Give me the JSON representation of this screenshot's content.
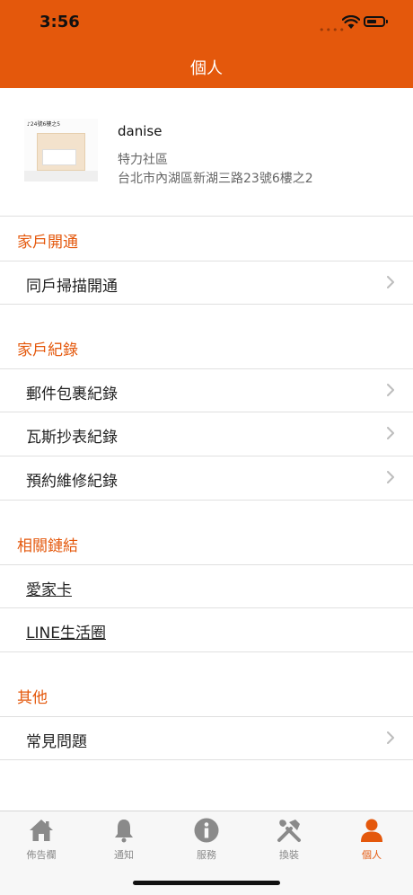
{
  "status": {
    "time": "3:56"
  },
  "header": {
    "title": "個人"
  },
  "profile": {
    "image_caption": "♪24號6樓之5",
    "username": "danise",
    "community": "特力社區",
    "address": "台北市內湖區新湖三路23號6樓之2"
  },
  "sections": {
    "activation": {
      "title": "家戶開通",
      "items": [
        {
          "label": "同戶掃描開通"
        }
      ]
    },
    "records": {
      "title": "家戶紀錄",
      "items": [
        {
          "label": "郵件包裹紀錄"
        },
        {
          "label": "瓦斯抄表紀錄"
        },
        {
          "label": "預約維修紀錄"
        }
      ]
    },
    "links": {
      "title": "相關鏈結",
      "items": [
        {
          "label": "愛家卡"
        },
        {
          "label": "LINE生活圈"
        }
      ]
    },
    "other": {
      "title": "其他",
      "items": [
        {
          "label": "常見問題"
        }
      ]
    }
  },
  "tabbar": {
    "tabs": [
      {
        "label": "佈告欄",
        "icon": "house-icon"
      },
      {
        "label": "通知",
        "icon": "bell-icon"
      },
      {
        "label": "服務",
        "icon": "info-icon"
      },
      {
        "label": "換裝",
        "icon": "tools-icon"
      },
      {
        "label": "個人",
        "icon": "person-icon"
      }
    ],
    "active_index": 4
  },
  "colors": {
    "accent": "#e4580c",
    "tab_inactive": "#8a8a8a",
    "separator": "#e0e0e0"
  }
}
